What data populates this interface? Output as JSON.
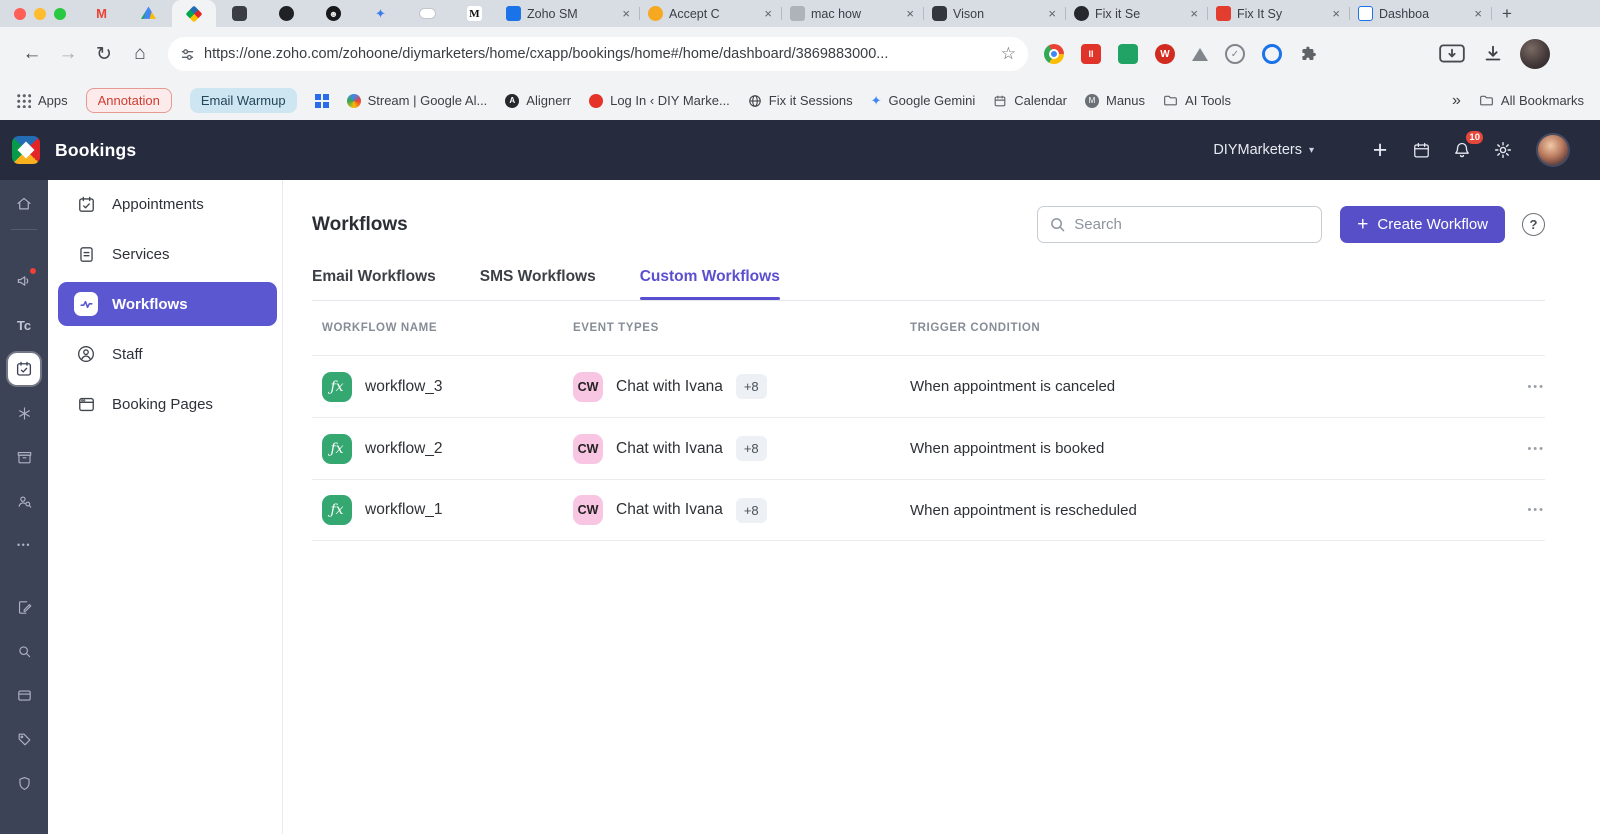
{
  "icons": {
    "gmail_m": "M",
    "medium_m": "M",
    "face": "☻",
    "spark": "✦",
    "gemini_spark": "✦",
    "close": "×",
    "plus": "+",
    "back": "←",
    "forward": "→",
    "reload": "↻",
    "home": "⌂",
    "star": "☆",
    "overflow": "»",
    "caret_down": "▾",
    "kebab": "•••",
    "more_dots": "•••",
    "tc": "Tc",
    "fx": "ƒx",
    "help": "?",
    "alignerr_a": "A",
    "redH": "II",
    "redW": "W"
  },
  "browser": {
    "url": "https://one.zoho.com/zohoone/diymarketers/home/cxapp/bookings/home#/home/dashboard/3869883000...",
    "tabs": [
      {
        "title": "Zoho SM"
      },
      {
        "title": "Accept C"
      },
      {
        "title": "mac how"
      },
      {
        "title": "Vison"
      },
      {
        "title": "Fix it Se"
      },
      {
        "title": "Fix It Sy"
      },
      {
        "title": "Dashboa"
      }
    ],
    "bookmarks": [
      {
        "label": "Apps"
      },
      {
        "label": "Annotation"
      },
      {
        "label": "Email Warmup"
      },
      {
        "label": "Stream | Google Al..."
      },
      {
        "label": "Alignerr"
      },
      {
        "label": "Log In ‹ DIY Marke..."
      },
      {
        "label": "Fix it Sessions"
      },
      {
        "label": "Google Gemini"
      },
      {
        "label": "Calendar"
      },
      {
        "label": "Manus"
      },
      {
        "label": "AI Tools"
      }
    ],
    "all_bookmarks": "All Bookmarks"
  },
  "app": {
    "title": "Bookings",
    "workspace": "DIYMarketers",
    "notification_count": "10",
    "sidebar": [
      {
        "label": "Appointments"
      },
      {
        "label": "Services"
      },
      {
        "label": "Workflows"
      },
      {
        "label": "Staff"
      },
      {
        "label": "Booking Pages"
      }
    ],
    "page": {
      "title": "Workflows",
      "search_placeholder": "Search",
      "create_button": "Create Workflow",
      "tabs": [
        {
          "label": "Email Workflows"
        },
        {
          "label": "SMS Workflows"
        },
        {
          "label": "Custom Workflows"
        }
      ],
      "table": {
        "headers": [
          "WORKFLOW NAME",
          "EVENT TYPES",
          "TRIGGER CONDITION"
        ],
        "rows": [
          {
            "name": "workflow_3",
            "badge": "CW",
            "event": "Chat with Ivana",
            "more": "+8",
            "trigger": "When appointment is canceled"
          },
          {
            "name": "workflow_2",
            "badge": "CW",
            "event": "Chat with Ivana",
            "more": "+8",
            "trigger": "When appointment is booked"
          },
          {
            "name": "workflow_1",
            "badge": "CW",
            "event": "Chat with Ivana",
            "more": "+8",
            "trigger": "When appointment is rescheduled"
          }
        ]
      }
    }
  },
  "colors": {
    "accent_purple": "#564fc8",
    "sidebar_selected_purple": "#5b57d1",
    "active_tab_purple": "#5a4fd0",
    "fx_green": "#35a871",
    "cw_pink": "#f8c5e2",
    "header_dark": "#262b3e",
    "rail_dark": "#3d4356",
    "notification_red": "#e8483c"
  }
}
